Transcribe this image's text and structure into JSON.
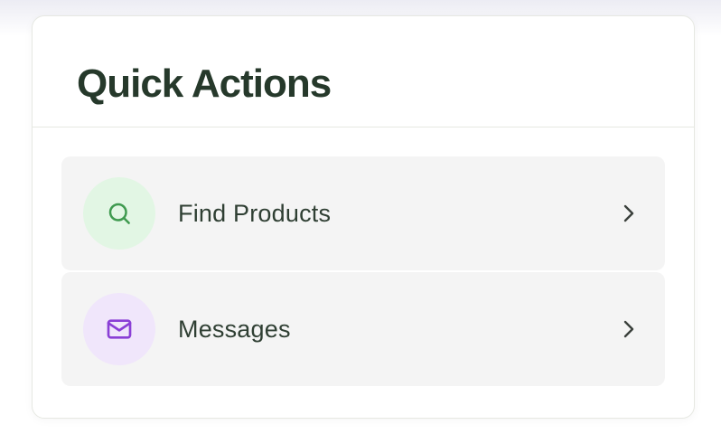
{
  "card": {
    "title": "Quick Actions"
  },
  "actions": [
    {
      "label": "Find Products",
      "icon": "search-icon",
      "icon_color": "#3f9a4f",
      "icon_bg": "#e2f6e4"
    },
    {
      "label": "Messages",
      "icon": "mail-icon",
      "icon_color": "#8a3fd6",
      "icon_bg": "#f0e6fb"
    }
  ],
  "colors": {
    "title": "#26392b",
    "item_bg": "#f4f4f4",
    "border": "#e6e8e2"
  }
}
